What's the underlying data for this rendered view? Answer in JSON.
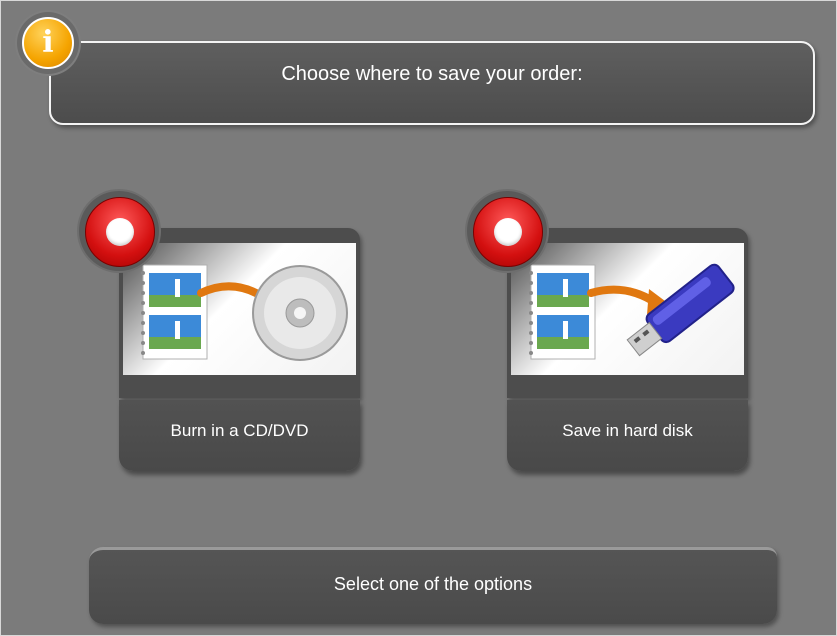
{
  "header": {
    "title": "Choose where to save your order:",
    "icon": "info-icon",
    "icon_glyph": "i"
  },
  "options": [
    {
      "label": "Burn in a CD/DVD",
      "illustration": "photos-to-disc-icon",
      "selected": false
    },
    {
      "label": "Save in hard disk",
      "illustration": "photos-to-usb-drive-icon",
      "selected": false
    }
  ],
  "status": {
    "message": "Select one of the options"
  },
  "colors": {
    "background": "#7b7b7b",
    "panel": "#4d4d4d",
    "radio_red": "#d41010",
    "info_orange": "#f5a400",
    "arrow_orange": "#e07810",
    "usb_blue": "#3a3ac0"
  }
}
